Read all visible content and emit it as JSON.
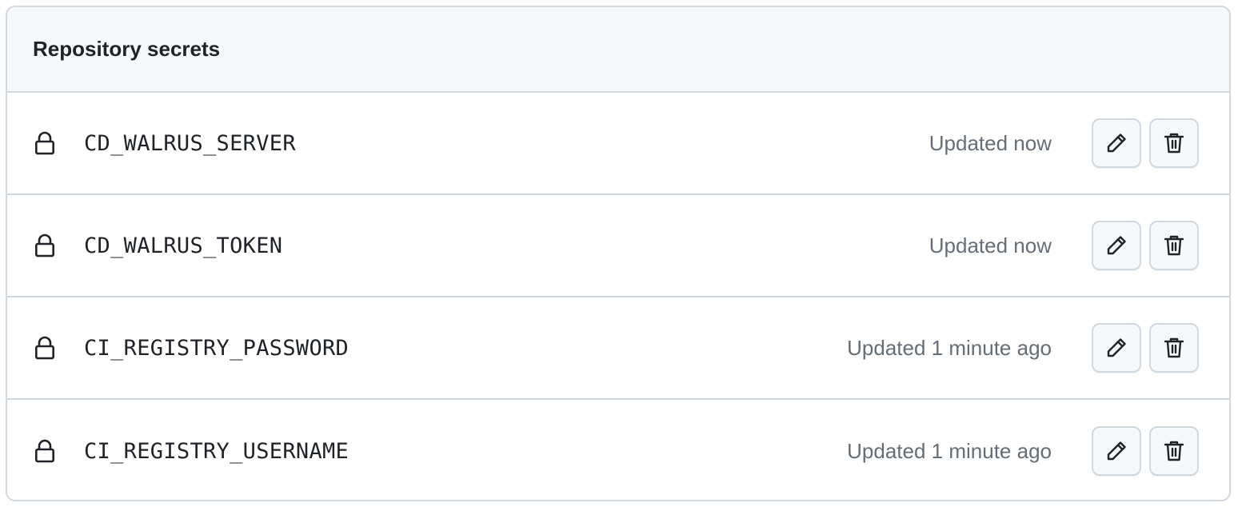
{
  "panel": {
    "title": "Repository secrets"
  },
  "secrets": [
    {
      "name": "CD_WALRUS_SERVER",
      "updated": "Updated now",
      "icon": "lock-icon"
    },
    {
      "name": "CD_WALRUS_TOKEN",
      "updated": "Updated now",
      "icon": "lock-icon"
    },
    {
      "name": "CI_REGISTRY_PASSWORD",
      "updated": "Updated 1 minute ago",
      "icon": "lock-icon"
    },
    {
      "name": "CI_REGISTRY_USERNAME",
      "updated": "Updated 1 minute ago",
      "icon": "lock-icon"
    }
  ],
  "actions": {
    "edit_icon": "pencil-icon",
    "delete_icon": "trash-icon"
  },
  "colors": {
    "border": "#d0d7de",
    "header_bg": "#f6f8fa",
    "text": "#1f2328",
    "muted_text": "#656d76"
  }
}
